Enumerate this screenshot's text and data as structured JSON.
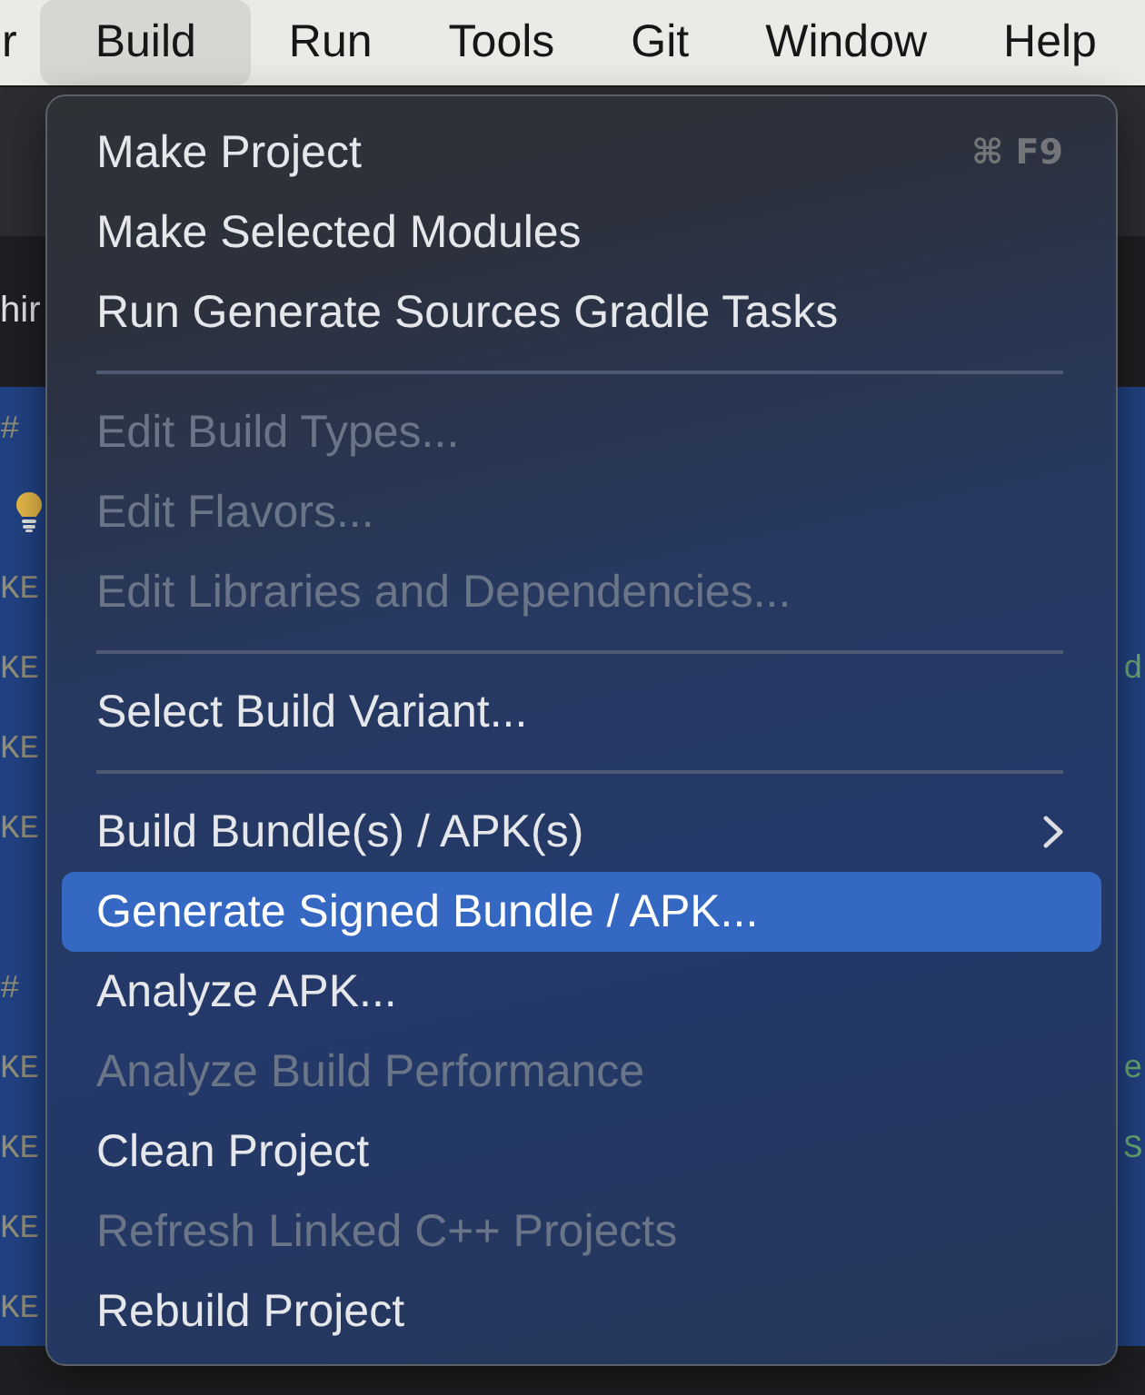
{
  "menubar": {
    "items": [
      {
        "label": "r",
        "selected": false
      },
      {
        "label": "Build",
        "selected": true
      },
      {
        "label": "Run",
        "selected": false
      },
      {
        "label": "Tools",
        "selected": false
      },
      {
        "label": "Git",
        "selected": false
      },
      {
        "label": "Window",
        "selected": false
      },
      {
        "label": "Help",
        "selected": false
      }
    ]
  },
  "editor": {
    "tab_label": "hir",
    "lines": [
      {
        "kind": "code",
        "start": "#"
      },
      {
        "kind": "bulb"
      },
      {
        "kind": "code",
        "start": "KE"
      },
      {
        "kind": "code",
        "start": "KE",
        "end": "d"
      },
      {
        "kind": "code",
        "start": "KE"
      },
      {
        "kind": "code",
        "start": "KE"
      },
      {
        "kind": "blank"
      },
      {
        "kind": "code",
        "start": "#"
      },
      {
        "kind": "code",
        "start": "KE",
        "end": "e"
      },
      {
        "kind": "code",
        "start": "KE",
        "end": "S"
      },
      {
        "kind": "code",
        "start": "KE"
      },
      {
        "kind": "code",
        "start": "KE"
      }
    ]
  },
  "menu": {
    "items": [
      {
        "kind": "item",
        "label": "Make Project",
        "shortcut": "⌘ F9",
        "disabled": false,
        "selected": false
      },
      {
        "kind": "item",
        "label": "Make Selected Modules",
        "disabled": false,
        "selected": false
      },
      {
        "kind": "item",
        "label": "Run Generate Sources Gradle Tasks",
        "disabled": false,
        "selected": false
      },
      {
        "kind": "separator"
      },
      {
        "kind": "item",
        "label": "Edit Build Types...",
        "disabled": true,
        "selected": false
      },
      {
        "kind": "item",
        "label": "Edit Flavors...",
        "disabled": true,
        "selected": false
      },
      {
        "kind": "item",
        "label": "Edit Libraries and Dependencies...",
        "disabled": true,
        "selected": false
      },
      {
        "kind": "separator"
      },
      {
        "kind": "item",
        "label": "Select Build Variant...",
        "disabled": false,
        "selected": false
      },
      {
        "kind": "separator"
      },
      {
        "kind": "submenu",
        "label": "Build Bundle(s) / APK(s)",
        "disabled": false,
        "selected": false
      },
      {
        "kind": "item",
        "label": "Generate Signed Bundle / APK...",
        "disabled": false,
        "selected": true
      },
      {
        "kind": "item",
        "label": "Analyze APK...",
        "disabled": false,
        "selected": false
      },
      {
        "kind": "item",
        "label": "Analyze Build Performance",
        "disabled": true,
        "selected": false
      },
      {
        "kind": "item",
        "label": "Clean Project",
        "disabled": false,
        "selected": false
      },
      {
        "kind": "item",
        "label": "Refresh Linked C++ Projects",
        "disabled": true,
        "selected": false
      },
      {
        "kind": "item",
        "label": "Rebuild Project",
        "disabled": false,
        "selected": false
      }
    ]
  }
}
